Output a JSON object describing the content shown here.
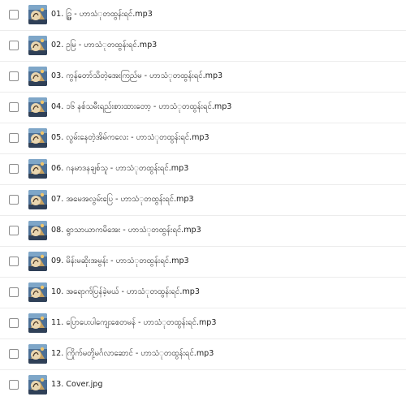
{
  "files": [
    {
      "name": "01. ဥ္ဖြ - ဟာသံုတထွန်းရင်.mp3",
      "thumbnail": "album-art-icon"
    },
    {
      "name": "02. ဥမြ - ဟာသံုတထွန်းရင်.mp3",
      "thumbnail": "album-art-icon"
    },
    {
      "name": "03. ကွန်တော်သိတဲ့အေးကြည်မ - ဟာသံုတထွန်းရင်.mp3",
      "thumbnail": "album-art-icon"
    },
    {
      "name": "04. ၁၆ နစ်သမီးရည်းစားထားတော့ - ဟာသံုတထွန်းရင်.mp3",
      "thumbnail": "album-art-icon"
    },
    {
      "name": "05. လွမ်းနေတဲ့အိမ်ကလေး - ဟာသံုတထွန်းရင်.mp3",
      "thumbnail": "album-art-icon"
    },
    {
      "name": "06. ဂနမာဒနချစ်သူ - ဟာသံုတထွန်းရင်.mp3",
      "thumbnail": "album-art-icon"
    },
    {
      "name": "07. အမေအလွမ်းပြေ - ဟာသံုတထွန်းရင်.mp3",
      "thumbnail": "album-art-icon"
    },
    {
      "name": "08. ရွာသာယာကမိအေး - ဟာသံုတထွန်းရင်.mp3",
      "thumbnail": "album-art-icon"
    },
    {
      "name": "09. မိန်းမဆိုးအမွန်း - ဟာသံုတထွန်းရင်.mp3",
      "thumbnail": "album-art-icon"
    },
    {
      "name": "10. အရောက်ပြန်ခဲ့မယ် - ဟာသံုတထွန်းရင်.mp3",
      "thumbnail": "album-art-icon"
    },
    {
      "name": "11. ပြောပေးပါကျေးစေတမန် - ဟာသံုတထွန်းရင်.mp3",
      "thumbnail": "album-art-icon"
    },
    {
      "name": "12. ကြိုက်မတို့မင်္ဂလာဆောင် - ဟာသံုတထွန်းရင်.mp3",
      "thumbnail": "album-art-icon"
    },
    {
      "name": "13. Cover.jpg",
      "thumbnail": "album-art-icon"
    }
  ]
}
